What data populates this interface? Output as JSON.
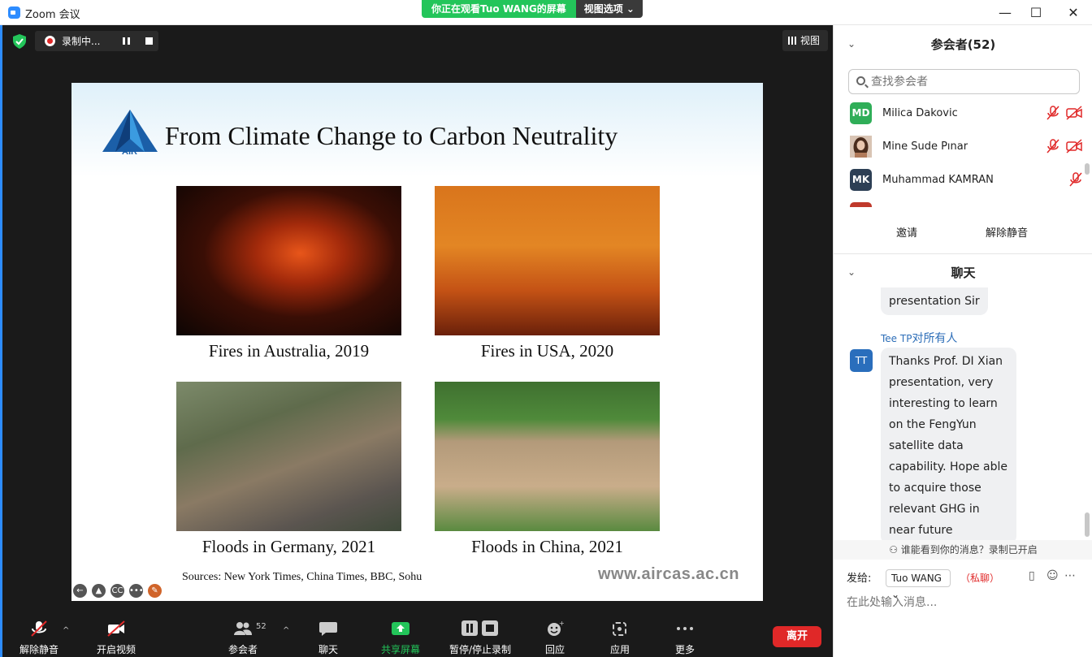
{
  "window": {
    "title": "Zoom 会议",
    "share_banner": "你正在观看Tuo WANG的屏幕",
    "view_options": "视图选项 ⌄",
    "minimize": "—",
    "maximize": "☐",
    "close": "✕"
  },
  "meeting_bar": {
    "recording_label": "录制中...",
    "view_label": "视图"
  },
  "slide": {
    "title": "From Climate Change to Carbon Neutrality",
    "logo_text": "AIR",
    "captions": [
      "Fires in Australia, 2019",
      "Fires in USA, 2020",
      "Floods in Germany, 2021",
      "Floods in China, 2021"
    ],
    "sources": "Sources: New York Times, China Times, BBC, Sohu",
    "url": "www.aircas.ac.cn",
    "control_icons": [
      "←",
      "▲",
      "CC",
      "•••",
      "✎"
    ]
  },
  "toolbar": {
    "unmute": "解除静音",
    "start_video": "开启视频",
    "participants": "参会者",
    "participants_count": "52",
    "chat": "聊天",
    "share_screen": "共享屏幕",
    "pause_stop_recording": "暂停/停止录制",
    "reactions": "回应",
    "apps": "应用",
    "more": "更多",
    "leave": "离开"
  },
  "participants_panel": {
    "header": "参会者(52)",
    "search_placeholder": "查找参会者",
    "participants": [
      {
        "initials": "MD",
        "name": "Milica Dakovic",
        "color": "#2fae58"
      },
      {
        "initials": "",
        "name": "Mine Sude Pınar",
        "color": "#c79a80"
      },
      {
        "initials": "MK",
        "name": "Muhammad KAMRAN",
        "color": "#2d3f55"
      }
    ],
    "invite": "邀请",
    "unmute_me": "解除静音"
  },
  "chat_panel": {
    "header": "聊天",
    "prev_tail": "presentation Sir",
    "sender": "Tee TP",
    "to_prefix": "对",
    "to_everyone": "所有人",
    "sender_initials": "TT",
    "message": "Thanks Prof. DI Xian presentation, very interesting to learn on the FengYun satellite data capability. Hope able to acquire those relevant GHG in near future",
    "visibility_note": "谁能看到你的消息？录制已开启",
    "send_to_label": "发给:",
    "send_to_value": "Tuo WANG ⌄",
    "private_tag": "（私聊）",
    "input_placeholder": "在此处输入消息..."
  }
}
